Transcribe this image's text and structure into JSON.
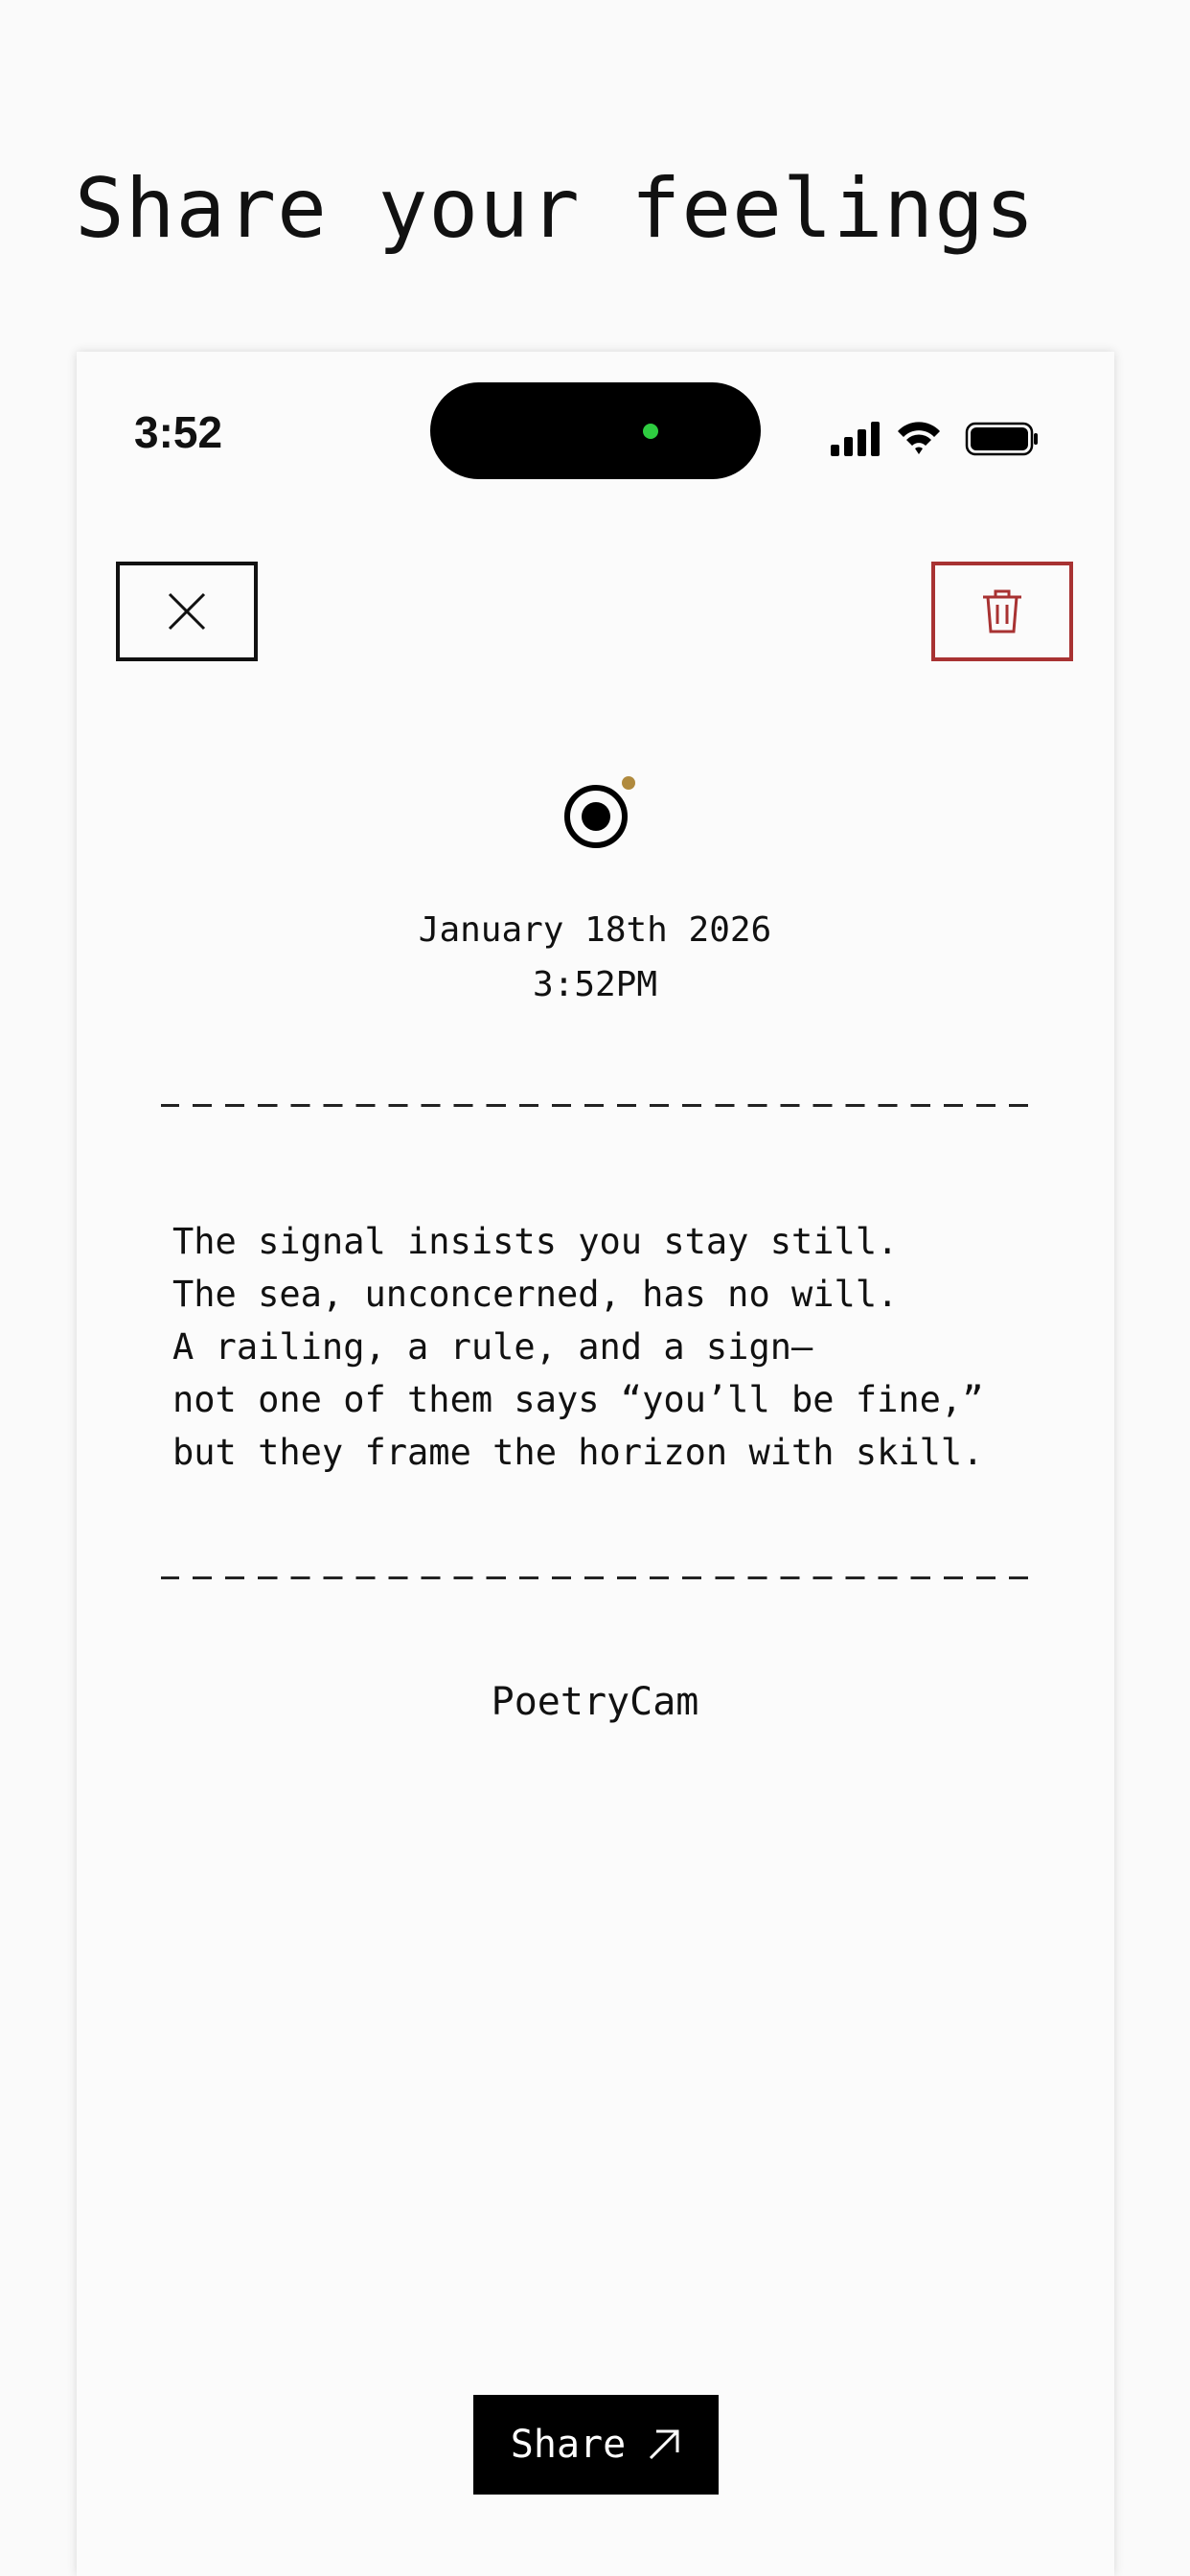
{
  "page": {
    "title": "Share your feelings"
  },
  "status_bar": {
    "time": "3:52",
    "icons": [
      "cellular-signal-icon",
      "wifi-icon",
      "battery-icon"
    ]
  },
  "toolbar": {
    "close_icon": "close-icon",
    "delete_icon": "trash-icon"
  },
  "entry": {
    "logo_icon": "camera-shutter-icon",
    "date": "January 18th 2026",
    "time": "3:52PM",
    "poem": "The signal insists you stay still.\nThe sea, unconcerned, has no will.\nA railing, a rule, and a sign—\nnot one of them says “you’ll be fine,”\nbut they frame the horizon with skill.",
    "brand": "PoetryCam"
  },
  "actions": {
    "share_label": "Share",
    "share_icon": "arrow-up-right-icon"
  },
  "colors": {
    "background": "#fafafa",
    "delete_accent": "#a83232",
    "logo_dot": "#b08a3e",
    "camera_indicator": "#2ecc40"
  }
}
